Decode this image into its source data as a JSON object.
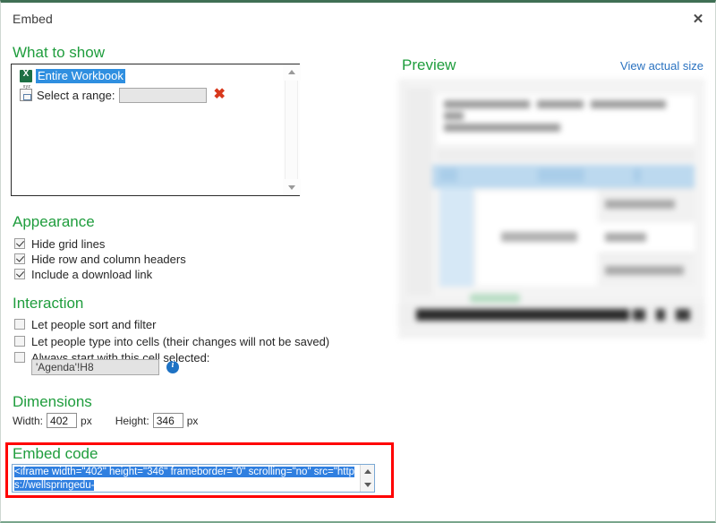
{
  "dialog": {
    "title": "Embed",
    "close_label": "✕"
  },
  "what_to_show": {
    "heading": "What to show",
    "entire_workbook_label": "Entire Workbook",
    "select_range_label": "Select a range:",
    "range_value": "",
    "range_placeholder": "",
    "clear_icon": "✖"
  },
  "appearance": {
    "heading": "Appearance",
    "options": [
      {
        "label": "Hide grid lines",
        "checked": true
      },
      {
        "label": "Hide row and column headers",
        "checked": true
      },
      {
        "label": "Include a download link",
        "checked": true
      }
    ]
  },
  "interaction": {
    "heading": "Interaction",
    "options": [
      {
        "label": "Let people sort and filter",
        "checked": false
      },
      {
        "label": "Let people type into cells (their changes will not be saved)",
        "checked": false
      },
      {
        "label": "Always start with this cell selected:",
        "checked": false
      }
    ],
    "cell_reference": "'Agenda'!H8",
    "info_icon": "info-icon"
  },
  "dimensions": {
    "heading": "Dimensions",
    "width_label": "Width:",
    "width_value": "402",
    "width_unit": "px",
    "height_label": "Height:",
    "height_value": "346",
    "height_unit": "px"
  },
  "embed_code": {
    "heading": "Embed code",
    "selected_text": "<iframe width=\"402\" height=\"346\" frameborder=\"0\" scrolling=\"no\" src=\"https://wellspringedu-",
    "annotation_color": "#ff0000"
  },
  "preview": {
    "heading": "Preview",
    "view_actual_size_label": "View actual size"
  },
  "colors": {
    "heading_green": "#1f9d3d",
    "link_blue": "#2a72c0",
    "selection_blue": "#2f8fe0",
    "accent_red": "#d8381c",
    "window_border_green": "#3f6f54"
  }
}
